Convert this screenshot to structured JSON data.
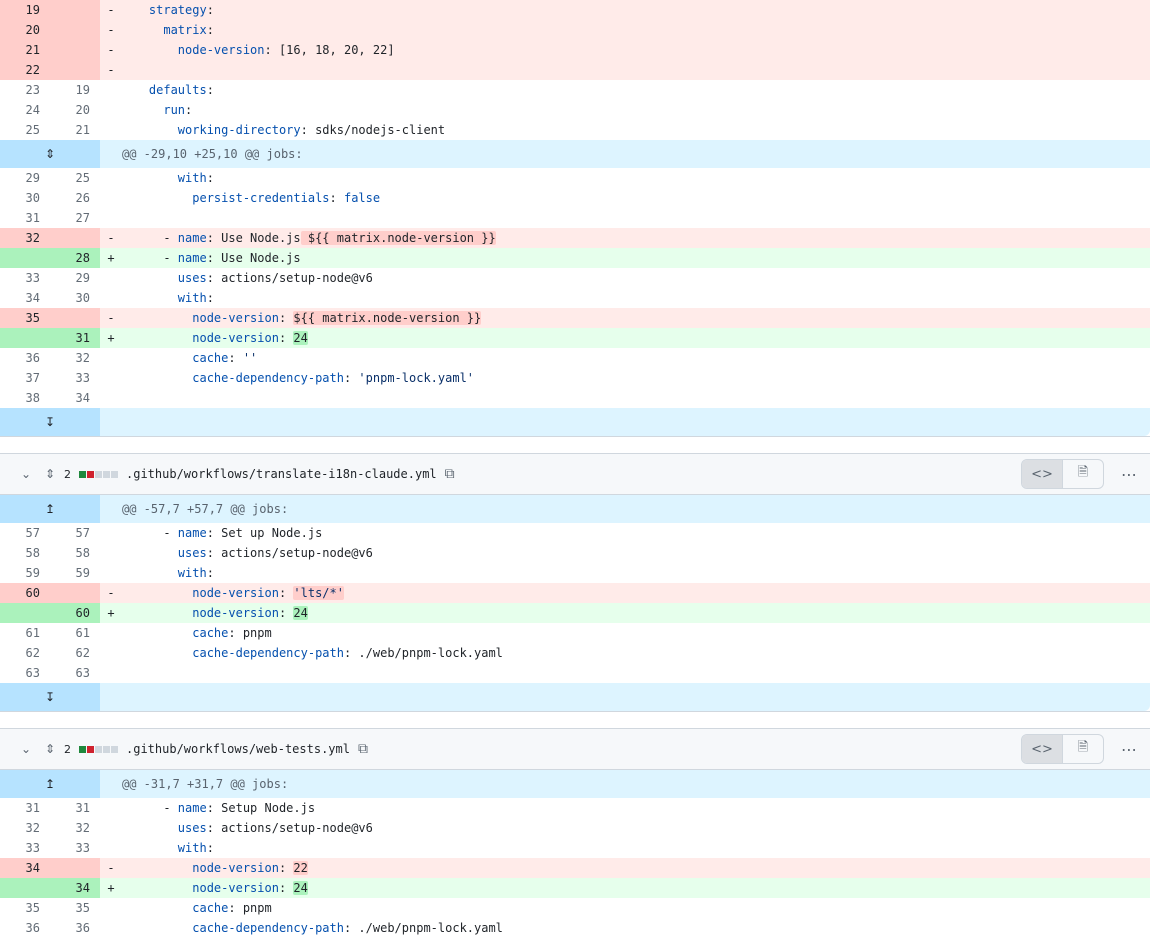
{
  "file1": {
    "top_lines": [
      {
        "type": "del",
        "old": "19",
        "new": "",
        "sign": "-",
        "segments": [
          {
            "t": "    "
          },
          {
            "t": "strategy",
            "c": "k"
          },
          {
            "t": ":"
          }
        ]
      },
      {
        "type": "del",
        "old": "20",
        "new": "",
        "sign": "-",
        "segments": [
          {
            "t": "      "
          },
          {
            "t": "matrix",
            "c": "k"
          },
          {
            "t": ":"
          }
        ]
      },
      {
        "type": "del",
        "old": "21",
        "new": "",
        "sign": "-",
        "segments": [
          {
            "t": "        "
          },
          {
            "t": "node-version",
            "c": "k"
          },
          {
            "t": ": [16, 18, 20, 22]"
          }
        ]
      },
      {
        "type": "del",
        "old": "22",
        "new": "",
        "sign": "-",
        "segments": [
          {
            "t": ""
          }
        ]
      },
      {
        "type": "ctx",
        "old": "23",
        "new": "19",
        "sign": "",
        "segments": [
          {
            "t": "    "
          },
          {
            "t": "defaults",
            "c": "k"
          },
          {
            "t": ":"
          }
        ]
      },
      {
        "type": "ctx",
        "old": "24",
        "new": "20",
        "sign": "",
        "segments": [
          {
            "t": "      "
          },
          {
            "t": "run",
            "c": "k"
          },
          {
            "t": ":"
          }
        ]
      },
      {
        "type": "ctx",
        "old": "25",
        "new": "21",
        "sign": "",
        "segments": [
          {
            "t": "        "
          },
          {
            "t": "working-directory",
            "c": "k"
          },
          {
            "t": ": sdks/nodejs-client"
          }
        ]
      }
    ],
    "hunk": "@@ -29,10 +25,10 @@ jobs:",
    "lines": [
      {
        "type": "ctx",
        "old": "29",
        "new": "25",
        "sign": "",
        "segments": [
          {
            "t": "        "
          },
          {
            "t": "with",
            "c": "k"
          },
          {
            "t": ":"
          }
        ]
      },
      {
        "type": "ctx",
        "old": "30",
        "new": "26",
        "sign": "",
        "segments": [
          {
            "t": "          "
          },
          {
            "t": "persist-credentials",
            "c": "k"
          },
          {
            "t": ": "
          },
          {
            "t": "false",
            "c": "k"
          }
        ]
      },
      {
        "type": "ctx",
        "old": "31",
        "new": "27",
        "sign": "",
        "segments": [
          {
            "t": ""
          }
        ]
      },
      {
        "type": "del",
        "old": "32",
        "new": "",
        "sign": "-",
        "segments": [
          {
            "t": "      - "
          },
          {
            "t": "name",
            "c": "k"
          },
          {
            "t": ": Use Node.js"
          },
          {
            "t": " ${{ matrix.node-version }}",
            "h": "del"
          }
        ]
      },
      {
        "type": "add",
        "old": "",
        "new": "28",
        "sign": "+",
        "segments": [
          {
            "t": "      - "
          },
          {
            "t": "name",
            "c": "k"
          },
          {
            "t": ": Use Node.js"
          }
        ]
      },
      {
        "type": "ctx",
        "old": "33",
        "new": "29",
        "sign": "",
        "segments": [
          {
            "t": "        "
          },
          {
            "t": "uses",
            "c": "k"
          },
          {
            "t": ": actions/setup-node@v6"
          }
        ]
      },
      {
        "type": "ctx",
        "old": "34",
        "new": "30",
        "sign": "",
        "segments": [
          {
            "t": "        "
          },
          {
            "t": "with",
            "c": "k"
          },
          {
            "t": ":"
          }
        ]
      },
      {
        "type": "del",
        "old": "35",
        "new": "",
        "sign": "-",
        "segments": [
          {
            "t": "          "
          },
          {
            "t": "node-version",
            "c": "k"
          },
          {
            "t": ": "
          },
          {
            "t": "${{ matrix.node-version }}",
            "h": "del"
          }
        ]
      },
      {
        "type": "add",
        "old": "",
        "new": "31",
        "sign": "+",
        "segments": [
          {
            "t": "          "
          },
          {
            "t": "node-version",
            "c": "k"
          },
          {
            "t": ": "
          },
          {
            "t": "24",
            "h": "add"
          }
        ]
      },
      {
        "type": "ctx",
        "old": "36",
        "new": "32",
        "sign": "",
        "segments": [
          {
            "t": "          "
          },
          {
            "t": "cache",
            "c": "k"
          },
          {
            "t": ": "
          },
          {
            "t": "''",
            "c": "s"
          }
        ]
      },
      {
        "type": "ctx",
        "old": "37",
        "new": "33",
        "sign": "",
        "segments": [
          {
            "t": "          "
          },
          {
            "t": "cache-dependency-path",
            "c": "k"
          },
          {
            "t": ": "
          },
          {
            "t": "'pnpm-lock.yaml'",
            "c": "s"
          }
        ]
      },
      {
        "type": "ctx",
        "old": "38",
        "new": "34",
        "sign": "",
        "segments": [
          {
            "t": ""
          }
        ]
      }
    ]
  },
  "file2": {
    "changes": "2",
    "path": ".github/workflows/translate-i18n-claude.yml",
    "hunk": "@@ -57,7 +57,7 @@ jobs:",
    "lines": [
      {
        "type": "ctx",
        "old": "57",
        "new": "57",
        "sign": "",
        "segments": [
          {
            "t": "      - "
          },
          {
            "t": "name",
            "c": "k"
          },
          {
            "t": ": Set up Node.js"
          }
        ]
      },
      {
        "type": "ctx",
        "old": "58",
        "new": "58",
        "sign": "",
        "segments": [
          {
            "t": "        "
          },
          {
            "t": "uses",
            "c": "k"
          },
          {
            "t": ": actions/setup-node@v6"
          }
        ]
      },
      {
        "type": "ctx",
        "old": "59",
        "new": "59",
        "sign": "",
        "segments": [
          {
            "t": "        "
          },
          {
            "t": "with",
            "c": "k"
          },
          {
            "t": ":"
          }
        ]
      },
      {
        "type": "del",
        "old": "60",
        "new": "",
        "sign": "-",
        "segments": [
          {
            "t": "          "
          },
          {
            "t": "node-version",
            "c": "k"
          },
          {
            "t": ": "
          },
          {
            "t": "'lts/*'",
            "h": "del",
            "c": "s"
          }
        ]
      },
      {
        "type": "add",
        "old": "",
        "new": "60",
        "sign": "+",
        "segments": [
          {
            "t": "          "
          },
          {
            "t": "node-version",
            "c": "k"
          },
          {
            "t": ": "
          },
          {
            "t": "24",
            "h": "add"
          }
        ]
      },
      {
        "type": "ctx",
        "old": "61",
        "new": "61",
        "sign": "",
        "segments": [
          {
            "t": "          "
          },
          {
            "t": "cache",
            "c": "k"
          },
          {
            "t": ": pnpm"
          }
        ]
      },
      {
        "type": "ctx",
        "old": "62",
        "new": "62",
        "sign": "",
        "segments": [
          {
            "t": "          "
          },
          {
            "t": "cache-dependency-path",
            "c": "k"
          },
          {
            "t": ": ./web/pnpm-lock.yaml"
          }
        ]
      },
      {
        "type": "ctx",
        "old": "63",
        "new": "63",
        "sign": "",
        "segments": [
          {
            "t": ""
          }
        ]
      }
    ]
  },
  "file3": {
    "changes": "2",
    "path": ".github/workflows/web-tests.yml",
    "hunk": "@@ -31,7 +31,7 @@ jobs:",
    "lines": [
      {
        "type": "ctx",
        "old": "31",
        "new": "31",
        "sign": "",
        "segments": [
          {
            "t": "      - "
          },
          {
            "t": "name",
            "c": "k"
          },
          {
            "t": ": Setup Node.js"
          }
        ]
      },
      {
        "type": "ctx",
        "old": "32",
        "new": "32",
        "sign": "",
        "segments": [
          {
            "t": "        "
          },
          {
            "t": "uses",
            "c": "k"
          },
          {
            "t": ": actions/setup-node@v6"
          }
        ]
      },
      {
        "type": "ctx",
        "old": "33",
        "new": "33",
        "sign": "",
        "segments": [
          {
            "t": "        "
          },
          {
            "t": "with",
            "c": "k"
          },
          {
            "t": ":"
          }
        ]
      },
      {
        "type": "del",
        "old": "34",
        "new": "",
        "sign": "-",
        "segments": [
          {
            "t": "          "
          },
          {
            "t": "node-version",
            "c": "k"
          },
          {
            "t": ": "
          },
          {
            "t": "22",
            "h": "del"
          }
        ]
      },
      {
        "type": "add",
        "old": "",
        "new": "34",
        "sign": "+",
        "segments": [
          {
            "t": "          "
          },
          {
            "t": "node-version",
            "c": "k"
          },
          {
            "t": ": "
          },
          {
            "t": "24",
            "h": "add"
          }
        ]
      },
      {
        "type": "ctx",
        "old": "35",
        "new": "35",
        "sign": "",
        "segments": [
          {
            "t": "          "
          },
          {
            "t": "cache",
            "c": "k"
          },
          {
            "t": ": pnpm"
          }
        ]
      },
      {
        "type": "ctx",
        "old": "36",
        "new": "36",
        "sign": "",
        "segments": [
          {
            "t": "          "
          },
          {
            "t": "cache-dependency-path",
            "c": "k"
          },
          {
            "t": ": ./web/pnpm-lock.yaml"
          }
        ]
      }
    ]
  },
  "icons": {
    "expand_both": "⇕",
    "expand_up": "↥",
    "expand_down": "↧",
    "chevron": "⌄",
    "copy": "⧉",
    "code_view": "<>",
    "file_view": "🗎",
    "more": "⋯"
  }
}
